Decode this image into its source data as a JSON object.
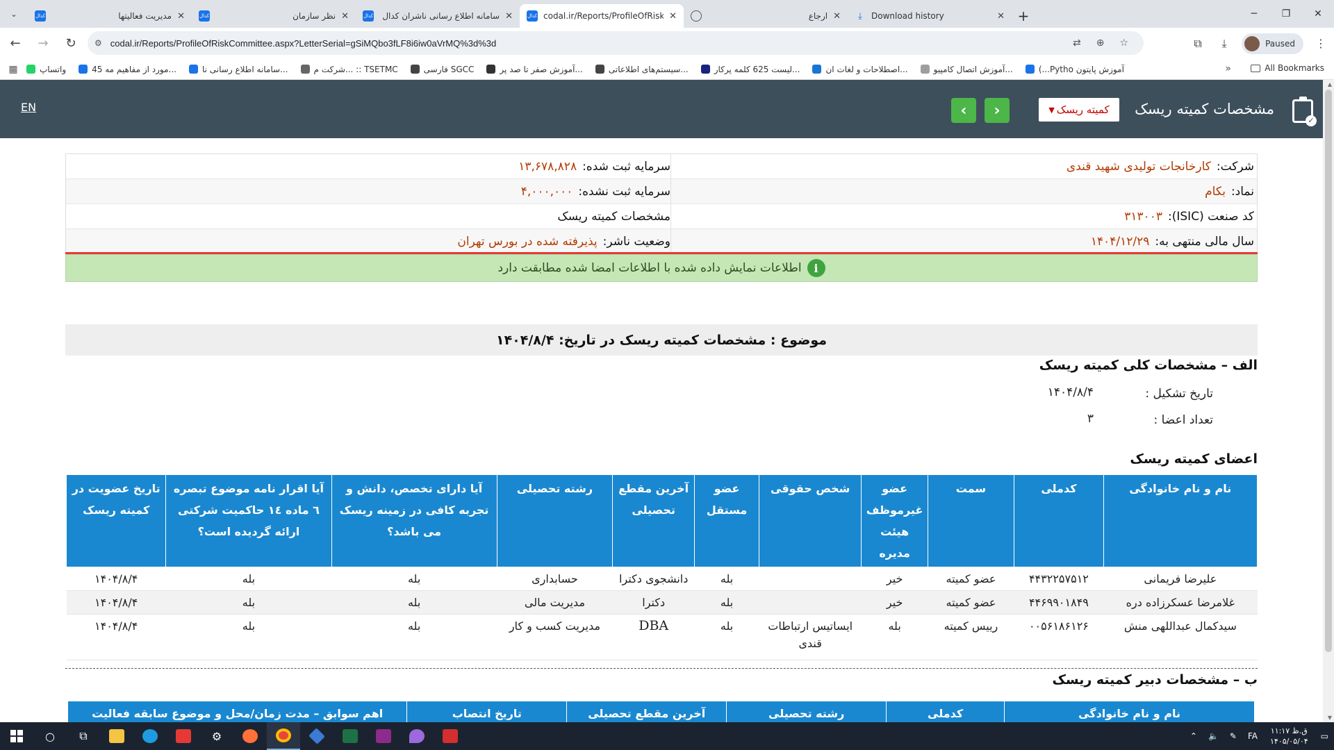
{
  "browser": {
    "tabs": [
      {
        "title": "مدیریت فعالیتها",
        "icon": "codal-favicon",
        "active": false
      },
      {
        "title": "نظر سازمان",
        "icon": "codal-favicon",
        "active": false
      },
      {
        "title": "سامانه اطلاع رسانی ناشران کدال",
        "icon": "codal-favicon",
        "active": false
      },
      {
        "title": "codal.ir/Reports/ProfileOfRiskC",
        "icon": "codal-favicon",
        "active": true
      },
      {
        "title": "ارجاع",
        "icon": "globe-icon",
        "active": false
      },
      {
        "title": "Download history",
        "icon": "download-icon",
        "active": false
      }
    ],
    "url": "codal.ir/Reports/ProfileOfRiskCommittee.aspx?LetterSerial=gSiMQbo3fLF8i6iw0aVrMQ%3d%3d",
    "profile_label": "Paused",
    "bookmarks": [
      {
        "label": "واتساپ",
        "color": "#25d366"
      },
      {
        "label": "45 مورد از مفاهیم مه...",
        "color": "#1a73e8"
      },
      {
        "label": "سامانه اطلاع رسانی نا...",
        "color": "#1a73e8"
      },
      {
        "label": "شرکت م... :: TSETMC",
        "color": "#666666"
      },
      {
        "label": "فارسی SGCC",
        "color": "#444444"
      },
      {
        "label": "آموزش صفر تا صد پر...",
        "color": "#333333"
      },
      {
        "label": "سیستم‌های اطلاعاتی...",
        "color": "#444444"
      },
      {
        "label": "لیست 625 کلمه پرکار...",
        "color": "#1a237e"
      },
      {
        "label": "اصطلاحات و لغات ان...",
        "color": "#1976d2"
      },
      {
        "label": "آموزش اتصال کامپیو...",
        "color": "#9e9e9e"
      },
      {
        "label": "(...Pytho آموزش پایتون",
        "color": "#1a73e8"
      }
    ],
    "all_bookmarks_label": "All Bookmarks"
  },
  "header": {
    "title": "مشخصات کمیته ریسک",
    "dropdown_label": "کمیته ریسک",
    "lang_label": "EN",
    "brand_color": "#3e4f5c",
    "nav_color": "#4cb648"
  },
  "info": {
    "company_label": "شرکت:",
    "company_value": "کارخانجات تولیدی شهید قندی",
    "symbol_label": "نماد:",
    "symbol_value": "بکام",
    "isic_label": "کد صنعت (ISIC):",
    "isic_value": "۳۱۳۰۰۳",
    "fiscal_label": "سال مالی منتهی به:",
    "fiscal_value": "۱۴۰۴/۱۲/۲۹",
    "reg_capital_label": "سرمایه ثبت شده:",
    "reg_capital_value": "۱۳,۶۷۸,۸۲۸",
    "unreg_capital_label": "سرمایه ثبت نشده:",
    "unreg_capital_value": "۴,۰۰۰,۰۰۰",
    "report_type": "مشخصات کمیته ریسک",
    "status_label": "وضعیت ناشر:",
    "status_value": "پذیرفته شده در بورس تهران",
    "verified_message": "اطلاعات نمایش داده شده با اطلاعات امضا شده مطابقت دارد"
  },
  "subject": "موضوع : مشخصات کمیته ریسک در تاریخ: ۱۴۰۴/۸/۴",
  "section_a": {
    "title": "الف – مشخصات کلی کمیته ریسک",
    "formation_label": "تاریخ تشکیل :",
    "formation_value": "۱۴۰۴/۸/۴",
    "members_count_label": "تعداد اعضا :",
    "members_count_value": "۳"
  },
  "members": {
    "title": "اعضای کمیته ریسک",
    "headers": [
      "نام و نام خانوادگی",
      "کدملی",
      "سمت",
      "عضو غیرموظف هیئت مدیره",
      "شخص حقوقی",
      "عضو مستقل",
      "آخرین مقطع تحصیلی",
      "رشته تحصیلی",
      "آیا دارای تخصص، دانش و تجربه کافی در زمینه ریسک می باشد؟",
      "آیا اقرار نامه موضوع تبصره ٦ ماده ١٤ حاکمیت شرکتی ارائه گردیده است؟",
      "تاریخ عضویت در کمیته ریسک"
    ],
    "rows": [
      [
        "علیرضا فریمانی",
        "۴۴۳۲۲۵۷۵۱۲",
        "عضو کمیته",
        "خیر",
        "",
        "بله",
        "دانشجوی دکترا",
        "حسابداری",
        "بله",
        "بله",
        "۱۴۰۴/۸/۴"
      ],
      [
        "غلامرضا عسکرزاده دره",
        "۴۴۶۹۹۰۱۸۴۹",
        "عضو کمیته",
        "خیر",
        "",
        "بله",
        "دکترا",
        "مدیریت مالی",
        "بله",
        "بله",
        "۱۴۰۴/۸/۴"
      ],
      [
        "سیدکمال عبداللهی منش",
        "۰۰۵۶۱۸۶۱۲۶",
        "رییس کمیته",
        "بله",
        "ایساتیس ارتباطات قندی",
        "بله",
        "DBA",
        "مدیریت کسب و کار",
        "بله",
        "بله",
        "۱۴۰۴/۸/۴"
      ]
    ]
  },
  "section_b": {
    "title": "ب – مشخصات دبیر کمیته ریسک",
    "headers": [
      "نام و نام خانوادگی",
      "کدملی",
      "رشته تحصیلی",
      "آخرین مقطع تحصیلی",
      "تاریخ انتصاب",
      "اهم سوابق – مدت زمان/محل و موضوع سابقه فعالیت"
    ]
  },
  "taskbar": {
    "lang": "FA",
    "time": "ق.ظ ۱۱:۱۷",
    "date": "۱۴۰۵/۰۵/۰۴"
  }
}
